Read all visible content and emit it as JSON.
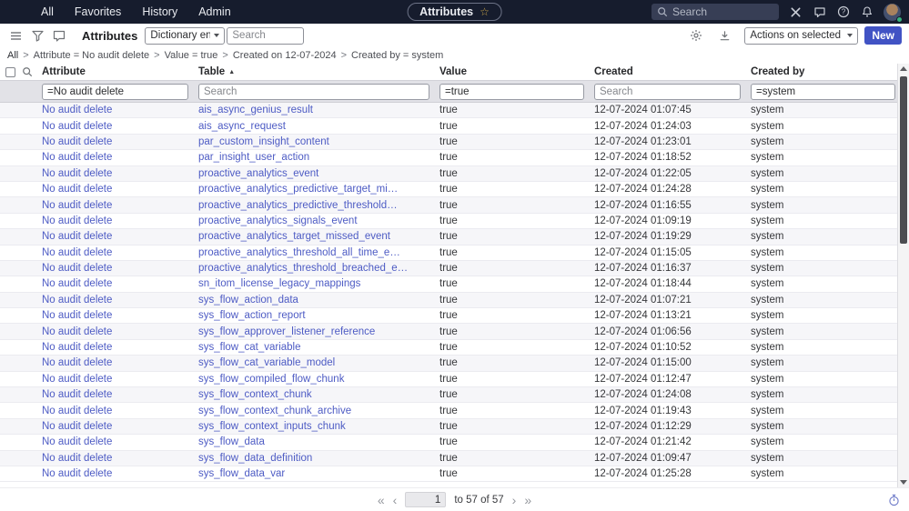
{
  "nav": {
    "items": [
      "All",
      "Favorites",
      "History",
      "Admin"
    ],
    "pill_label": "Attributes",
    "star_icon": "☆",
    "search_placeholder": "Search"
  },
  "toolbar": {
    "list_title": "Attributes",
    "table_selector_value": "Dictionary entry Tab",
    "search_placeholder": "Search",
    "actions_dropdown_value": "Actions on selected rows...",
    "new_button_label": "New"
  },
  "breadcrumb": {
    "separator": ">",
    "items": [
      "All",
      "Attribute = No audit delete",
      "Value = true",
      "Created on 12-07-2024",
      "Created by = system"
    ]
  },
  "table": {
    "columns": {
      "attribute": "Attribute",
      "table": "Table",
      "value": "Value",
      "created": "Created",
      "created_by": "Created by"
    },
    "sort_column": "Table",
    "sort_indicator": "▲",
    "filters": {
      "attribute_value": "=No audit delete",
      "table_placeholder": "Search",
      "value_value": "=true",
      "created_placeholder": "Search",
      "created_by_value": "=system"
    },
    "rows": [
      {
        "attribute": "No audit delete",
        "table": "ais_async_genius_result",
        "value": "true",
        "created": "12-07-2024 01:07:45",
        "created_by": "system"
      },
      {
        "attribute": "No audit delete",
        "table": "ais_async_request",
        "value": "true",
        "created": "12-07-2024 01:24:03",
        "created_by": "system"
      },
      {
        "attribute": "No audit delete",
        "table": "par_custom_insight_content",
        "value": "true",
        "created": "12-07-2024 01:23:01",
        "created_by": "system"
      },
      {
        "attribute": "No audit delete",
        "table": "par_insight_user_action",
        "value": "true",
        "created": "12-07-2024 01:18:52",
        "created_by": "system"
      },
      {
        "attribute": "No audit delete",
        "table": "proactive_analytics_event",
        "value": "true",
        "created": "12-07-2024 01:22:05",
        "created_by": "system"
      },
      {
        "attribute": "No audit delete",
        "table": "proactive_analytics_predictive_target_mi…",
        "value": "true",
        "created": "12-07-2024 01:24:28",
        "created_by": "system"
      },
      {
        "attribute": "No audit delete",
        "table": "proactive_analytics_predictive_threshold…",
        "value": "true",
        "created": "12-07-2024 01:16:55",
        "created_by": "system"
      },
      {
        "attribute": "No audit delete",
        "table": "proactive_analytics_signals_event",
        "value": "true",
        "created": "12-07-2024 01:09:19",
        "created_by": "system"
      },
      {
        "attribute": "No audit delete",
        "table": "proactive_analytics_target_missed_event",
        "value": "true",
        "created": "12-07-2024 01:19:29",
        "created_by": "system"
      },
      {
        "attribute": "No audit delete",
        "table": "proactive_analytics_threshold_all_time_e…",
        "value": "true",
        "created": "12-07-2024 01:15:05",
        "created_by": "system"
      },
      {
        "attribute": "No audit delete",
        "table": "proactive_analytics_threshold_breached_e…",
        "value": "true",
        "created": "12-07-2024 01:16:37",
        "created_by": "system"
      },
      {
        "attribute": "No audit delete",
        "table": "sn_itom_license_legacy_mappings",
        "value": "true",
        "created": "12-07-2024 01:18:44",
        "created_by": "system"
      },
      {
        "attribute": "No audit delete",
        "table": "sys_flow_action_data",
        "value": "true",
        "created": "12-07-2024 01:07:21",
        "created_by": "system"
      },
      {
        "attribute": "No audit delete",
        "table": "sys_flow_action_report",
        "value": "true",
        "created": "12-07-2024 01:13:21",
        "created_by": "system"
      },
      {
        "attribute": "No audit delete",
        "table": "sys_flow_approver_listener_reference",
        "value": "true",
        "created": "12-07-2024 01:06:56",
        "created_by": "system"
      },
      {
        "attribute": "No audit delete",
        "table": "sys_flow_cat_variable",
        "value": "true",
        "created": "12-07-2024 01:10:52",
        "created_by": "system"
      },
      {
        "attribute": "No audit delete",
        "table": "sys_flow_cat_variable_model",
        "value": "true",
        "created": "12-07-2024 01:15:00",
        "created_by": "system"
      },
      {
        "attribute": "No audit delete",
        "table": "sys_flow_compiled_flow_chunk",
        "value": "true",
        "created": "12-07-2024 01:12:47",
        "created_by": "system"
      },
      {
        "attribute": "No audit delete",
        "table": "sys_flow_context_chunk",
        "value": "true",
        "created": "12-07-2024 01:24:08",
        "created_by": "system"
      },
      {
        "attribute": "No audit delete",
        "table": "sys_flow_context_chunk_archive",
        "value": "true",
        "created": "12-07-2024 01:19:43",
        "created_by": "system"
      },
      {
        "attribute": "No audit delete",
        "table": "sys_flow_context_inputs_chunk",
        "value": "true",
        "created": "12-07-2024 01:12:29",
        "created_by": "system"
      },
      {
        "attribute": "No audit delete",
        "table": "sys_flow_data",
        "value": "true",
        "created": "12-07-2024 01:21:42",
        "created_by": "system"
      },
      {
        "attribute": "No audit delete",
        "table": "sys_flow_data_definition",
        "value": "true",
        "created": "12-07-2024 01:09:47",
        "created_by": "system"
      },
      {
        "attribute": "No audit delete",
        "table": "sys_flow_data_var",
        "value": "true",
        "created": "12-07-2024 01:25:28",
        "created_by": "system"
      }
    ]
  },
  "pagination": {
    "first_icon": "«",
    "prev_icon": "‹",
    "page_value": "1",
    "range_label": "to 57 of 57",
    "next_icon": "›",
    "last_icon": "»"
  }
}
